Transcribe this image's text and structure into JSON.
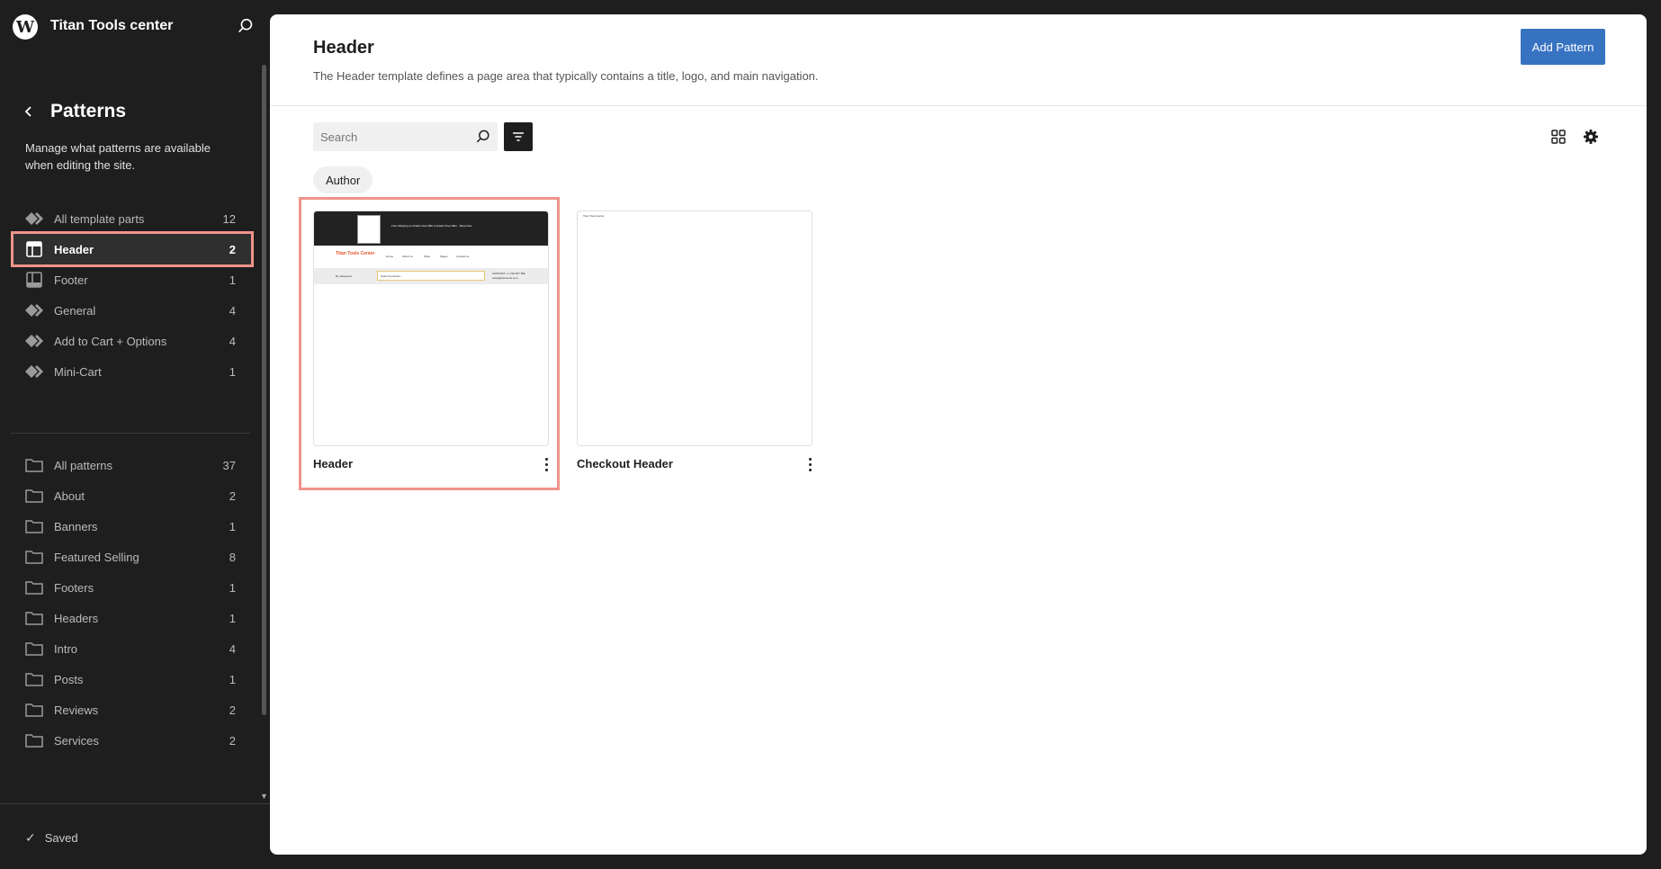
{
  "site": {
    "title": "Titan Tools center"
  },
  "sidebar": {
    "title": "Patterns",
    "description": "Manage what patterns are available when editing the site.",
    "template_parts": [
      {
        "label": "All template parts",
        "count": "12",
        "icon": "diamond-icon",
        "active": false
      },
      {
        "label": "Header",
        "count": "2",
        "icon": "header-layout-icon",
        "active": true
      },
      {
        "label": "Footer",
        "count": "1",
        "icon": "footer-layout-icon",
        "active": false
      },
      {
        "label": "General",
        "count": "4",
        "icon": "diamond-icon",
        "active": false
      },
      {
        "label": "Add to Cart + Options",
        "count": "4",
        "icon": "diamond-icon",
        "active": false
      },
      {
        "label": "Mini-Cart",
        "count": "1",
        "icon": "diamond-icon",
        "active": false
      }
    ],
    "categories": [
      {
        "label": "All patterns",
        "count": "37"
      },
      {
        "label": "About",
        "count": "2"
      },
      {
        "label": "Banners",
        "count": "1"
      },
      {
        "label": "Featured Selling",
        "count": "8"
      },
      {
        "label": "Footers",
        "count": "1"
      },
      {
        "label": "Headers",
        "count": "1"
      },
      {
        "label": "Intro",
        "count": "4"
      },
      {
        "label": "Posts",
        "count": "1"
      },
      {
        "label": "Reviews",
        "count": "2"
      },
      {
        "label": "Services",
        "count": "2"
      }
    ],
    "status": "Saved"
  },
  "main": {
    "title": "Header",
    "description": "The Header template defines a page area that typically contains a title, logo, and main navigation.",
    "add_button": "Add Pattern",
    "search": {
      "placeholder": "Search",
      "value": ""
    },
    "filter_chip": "Author",
    "patterns": [
      {
        "title": "Header",
        "selected": true,
        "preview": {
          "logo_label": "Titan Tools Center",
          "promo": "Free Shipping on Orders Over $50 | Limited Time Offer · Shop Now",
          "links": [
            "Home",
            "About us",
            "Shop",
            "Pages",
            "Contact us"
          ],
          "search_placeholder": "Search products…",
          "categories": "By categories",
          "support": "SUPPORT: +1 234 567 890",
          "email": "sales@titantools.com"
        }
      },
      {
        "title": "Checkout Header",
        "selected": false,
        "preview": {
          "site_label": "Titan Tools center"
        }
      }
    ]
  },
  "colors": {
    "accent": "#3873c2",
    "highlight": "#f0938a",
    "sidebar_bg": "#1e1e1e",
    "brand_orange": "#e2552c"
  }
}
